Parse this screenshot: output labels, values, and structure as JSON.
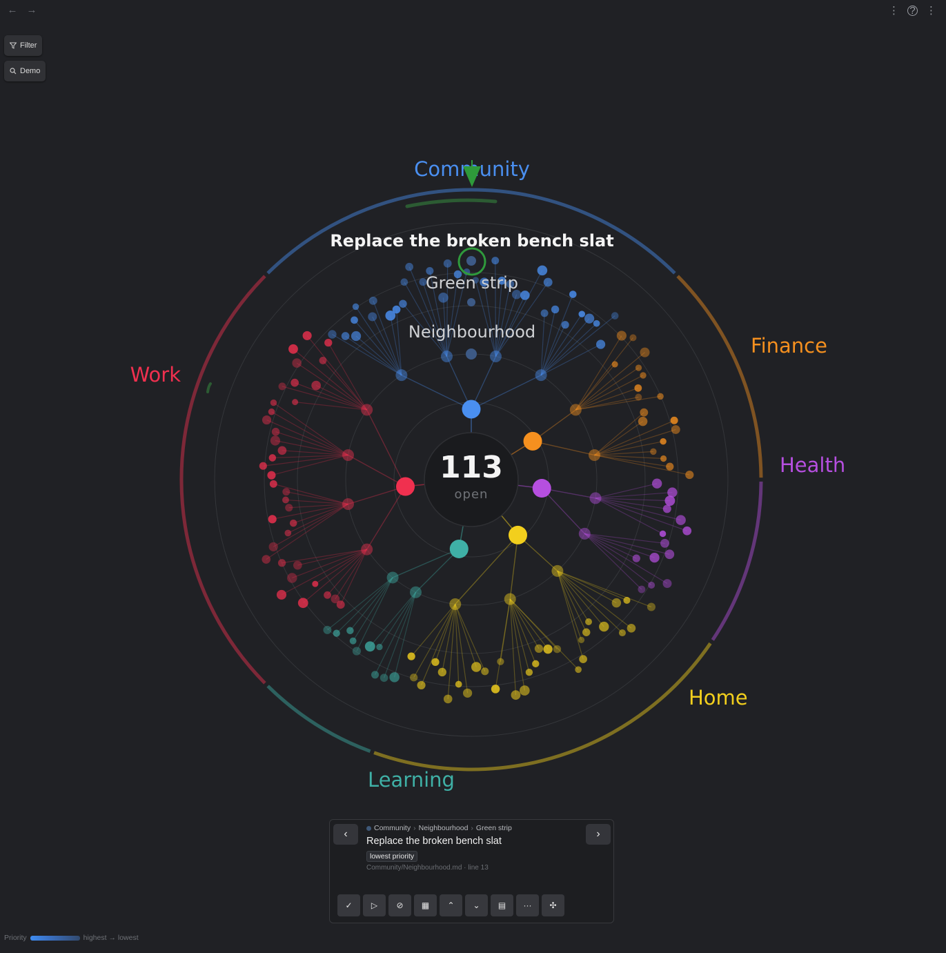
{
  "nav": {
    "back_icon": "←",
    "forward_icon": "→"
  },
  "toolbar_right": {
    "more_icon": "⋮",
    "help_icon": "?",
    "menu_icon": "⋮"
  },
  "side_buttons": {
    "filter": "Filter",
    "demo": "Demo"
  },
  "wheel": {
    "center_count": "113",
    "center_label": "open",
    "selected_task": "Replace the broken bench slat",
    "selected_group": "Green strip",
    "selected_area": "Neighbourhood",
    "categories": [
      {
        "name": "Community",
        "color": "#4a8ff0"
      },
      {
        "name": "Finance",
        "color": "#f5901f"
      },
      {
        "name": "Health",
        "color": "#b64fe0"
      },
      {
        "name": "Home",
        "color": "#f2cf1d"
      },
      {
        "name": "Learning",
        "color": "#3fb0a6"
      },
      {
        "name": "Work",
        "color": "#f0304f"
      }
    ]
  },
  "panel": {
    "crumb_1": "Community",
    "crumb_2": "Neighbourhood",
    "crumb_3": "Green strip",
    "crumb_sep": "›",
    "title": "Replace the broken bench slat",
    "badge": "lowest priority",
    "path": "Community/Neighbourhood.md · line 13",
    "prev_icon": "‹",
    "next_icon": "›",
    "actions": [
      {
        "name": "complete-icon",
        "glyph": "✓"
      },
      {
        "name": "start-icon",
        "glyph": "▷"
      },
      {
        "name": "cancel-icon",
        "glyph": "⊘"
      },
      {
        "name": "calendar-icon",
        "glyph": "▦"
      },
      {
        "name": "priority-up-icon",
        "glyph": "⌃"
      },
      {
        "name": "priority-down-icon",
        "glyph": "⌄"
      },
      {
        "name": "open-file-icon",
        "glyph": "▤"
      },
      {
        "name": "more-icon",
        "glyph": "···"
      },
      {
        "name": "focus-icon",
        "glyph": "✣"
      }
    ]
  },
  "legend": {
    "label": "Priority",
    "range": "highest → lowest"
  }
}
